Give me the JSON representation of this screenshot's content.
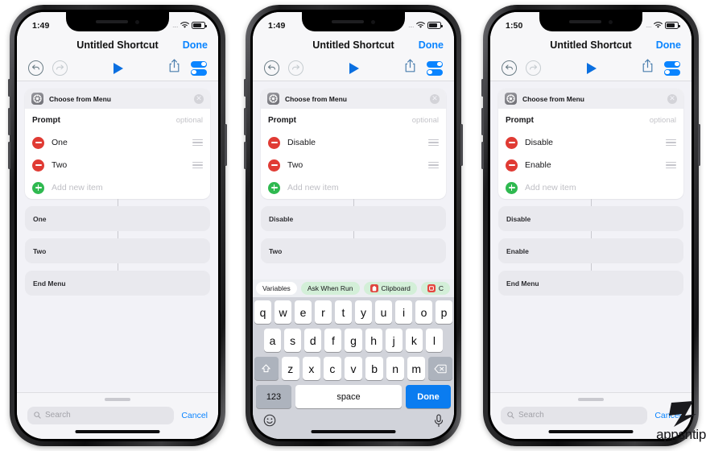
{
  "page": {
    "background": "#ffffff",
    "accent_blue": "#0a84ff",
    "remove_red": "#e03b34",
    "add_green": "#2fb950"
  },
  "watermark": {
    "text": "appsntip"
  },
  "phones": [
    {
      "id": "phone-1",
      "status": {
        "time": "1:49",
        "signal_dots": "....",
        "wifi": "wifi-icon",
        "battery": "battery-icon"
      },
      "nav": {
        "title": "Untitled Shortcut",
        "done_label": "Done"
      },
      "toolbar": {
        "undo": "undo-icon",
        "redo": "redo-icon",
        "play": "play-icon",
        "share": "share-icon",
        "settings": "settings-toggles-icon"
      },
      "card": {
        "title": "Choose from Menu",
        "icon": "shortcuts-gear-icon",
        "close": "close-icon",
        "prompt_label": "Prompt",
        "prompt_placeholder": "optional",
        "items": [
          {
            "label": "One",
            "action": "remove"
          },
          {
            "label": "Two",
            "action": "remove"
          }
        ],
        "add_label": "Add new item",
        "add_action": "add"
      },
      "blocks": [
        "One",
        "Two",
        "End Menu"
      ],
      "bottom": {
        "search_placeholder": "Search",
        "cancel_label": "Cancel"
      },
      "keyboard": null
    },
    {
      "id": "phone-2",
      "status": {
        "time": "1:49",
        "signal_dots": "....",
        "wifi": "wifi-icon",
        "battery": "battery-icon"
      },
      "nav": {
        "title": "Untitled Shortcut",
        "done_label": "Done"
      },
      "toolbar": {
        "undo": "undo-icon",
        "redo": "redo-icon",
        "play": "play-icon",
        "share": "share-icon",
        "settings": "settings-toggles-icon"
      },
      "card": {
        "title": "Choose from Menu",
        "icon": "shortcuts-gear-icon",
        "close": "close-icon",
        "prompt_label": "Prompt",
        "prompt_placeholder": "optional",
        "items": [
          {
            "label": "Disable",
            "action": "remove"
          },
          {
            "label": "Two",
            "action": "remove"
          }
        ],
        "add_label": "Add new item",
        "add_action": "add"
      },
      "blocks": [
        "Disable",
        "Two"
      ],
      "bottom": null,
      "keyboard": {
        "suggestions": [
          {
            "label": "Variables",
            "style": "white",
            "icon": null
          },
          {
            "label": "Ask When Run",
            "style": "green",
            "icon": null
          },
          {
            "label": "Clipboard",
            "style": "green",
            "icon": "clipboard-icon"
          },
          {
            "label": "C",
            "style": "green",
            "icon": "current-date-icon"
          }
        ],
        "row1": [
          "q",
          "w",
          "e",
          "r",
          "t",
          "y",
          "u",
          "i",
          "o",
          "p"
        ],
        "row2": [
          "a",
          "s",
          "d",
          "f",
          "g",
          "h",
          "j",
          "k",
          "l"
        ],
        "row3": [
          "z",
          "x",
          "c",
          "v",
          "b",
          "n",
          "m"
        ],
        "shift_key": "shift-icon",
        "delete_key": "delete-icon",
        "numbers_key": "123",
        "space_key": "space",
        "return_key": "Done",
        "emoji_key": "emoji-icon",
        "dictation_key": "microphone-icon"
      }
    },
    {
      "id": "phone-3",
      "status": {
        "time": "1:50",
        "signal_dots": "....",
        "wifi": "wifi-icon",
        "battery": "battery-icon"
      },
      "nav": {
        "title": "Untitled Shortcut",
        "done_label": "Done"
      },
      "toolbar": {
        "undo": "undo-icon",
        "redo": "redo-icon",
        "play": "play-icon",
        "share": "share-icon",
        "settings": "settings-toggles-icon"
      },
      "card": {
        "title": "Choose from Menu",
        "icon": "shortcuts-gear-icon",
        "close": "close-icon",
        "prompt_label": "Prompt",
        "prompt_placeholder": "optional",
        "items": [
          {
            "label": "Disable",
            "action": "remove"
          },
          {
            "label": "Enable",
            "action": "remove"
          }
        ],
        "add_label": "Add new item",
        "add_action": "add"
      },
      "blocks": [
        "Disable",
        "Enable",
        "End Menu"
      ],
      "bottom": {
        "search_placeholder": "Search",
        "cancel_label": "Cancel"
      },
      "keyboard": null
    }
  ]
}
